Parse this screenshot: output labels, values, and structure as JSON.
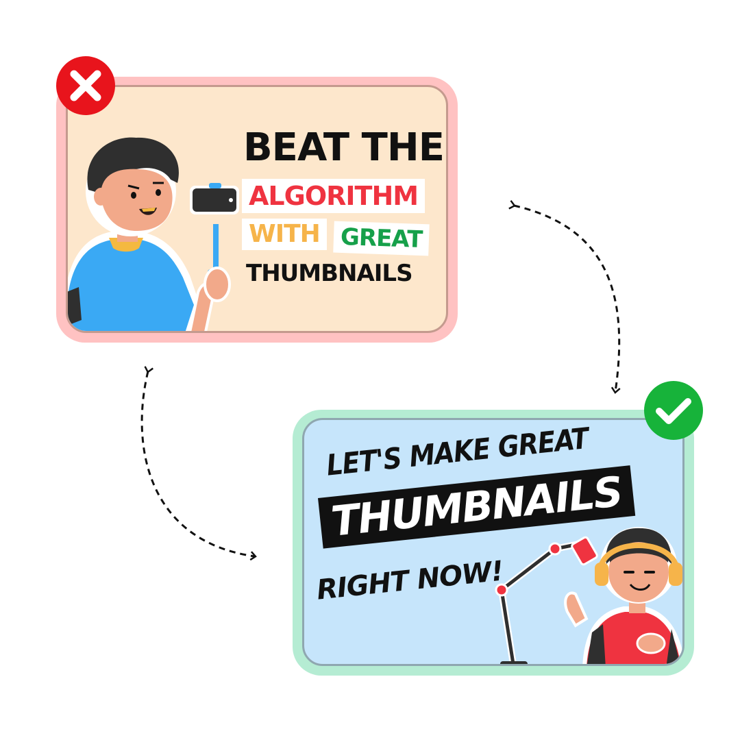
{
  "bad_card": {
    "line1": "BEAT THE",
    "line2": "ALGORITHM",
    "line3a": "WITH",
    "line3b": "GREAT",
    "line4": "THUMBNAILS"
  },
  "good_card": {
    "line1": "LET'S MAKE GREAT",
    "line2": "THUMBNAILS",
    "line3": "RIGHT NOW!"
  },
  "icons": {
    "bad_badge": "cross-icon",
    "good_badge": "check-icon"
  },
  "colors": {
    "bad_outer": "#ffc2c2",
    "bad_inner": "#fde7cc",
    "good_outer": "#b5ecd3",
    "good_inner": "#c6e5fb",
    "red_badge": "#e8141c",
    "green_badge": "#17b33a",
    "algorithm_red": "#ef3340",
    "with_yellow": "#f6b44a",
    "great_green": "#16a04a"
  }
}
